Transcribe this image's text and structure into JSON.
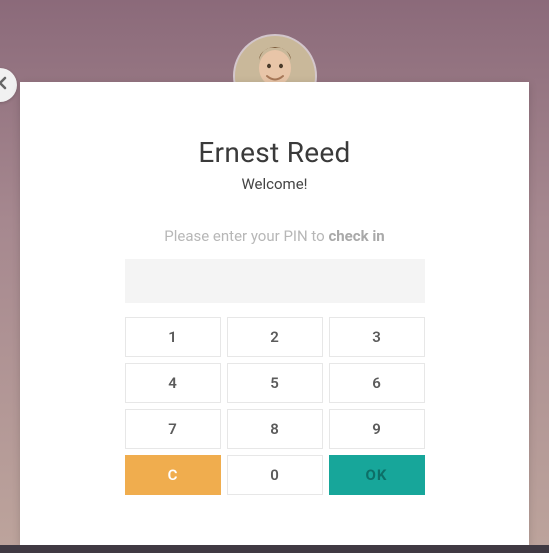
{
  "user": {
    "name": "Ernest Reed",
    "welcome": "Welcome!"
  },
  "prompt": {
    "prefix": "Please enter your PIN to ",
    "action": "check in"
  },
  "keypad": {
    "k1": "1",
    "k2": "2",
    "k3": "3",
    "k4": "4",
    "k5": "5",
    "k6": "6",
    "k7": "7",
    "k8": "8",
    "k9": "9",
    "clear": "C",
    "k0": "0",
    "ok": "OK"
  },
  "colors": {
    "clear_bg": "#f0ad4e",
    "ok_bg": "#17a69a"
  }
}
